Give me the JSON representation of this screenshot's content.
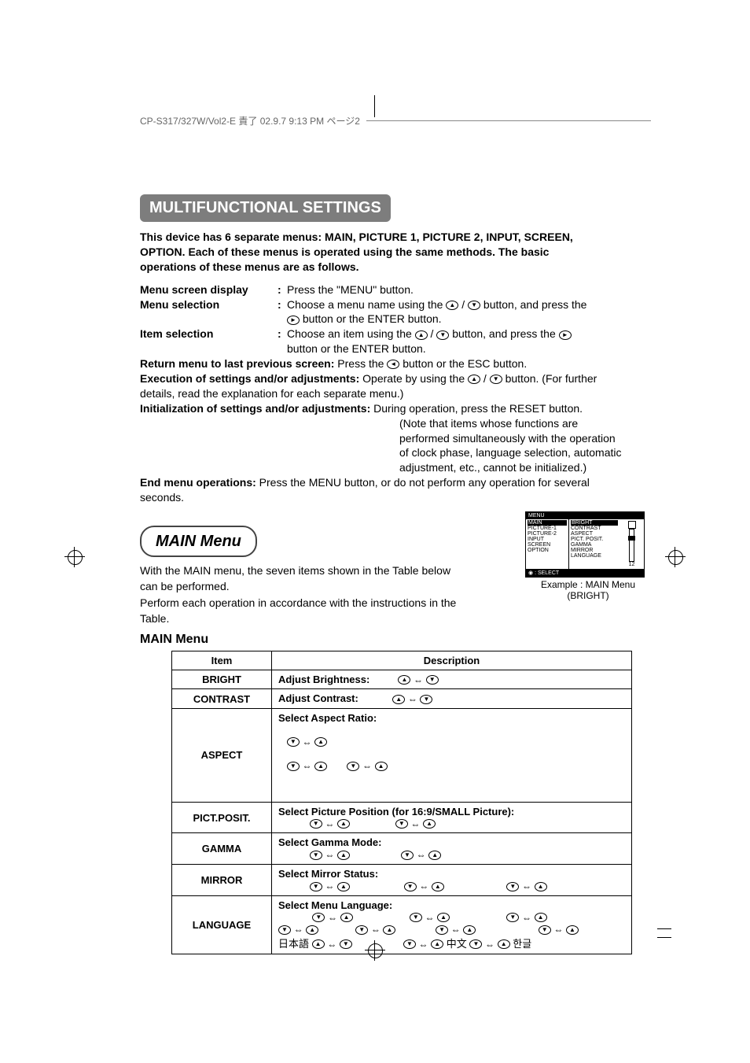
{
  "header": {
    "slug": "CP-S317/327W/Vol2-E  責了  02.9.7  9:13 PM   ページ2"
  },
  "section_title": "MULTIFUNCTIONAL SETTINGS",
  "intro": "This device has 6 separate menus: MAIN, PICTURE 1, PICTURE 2, INPUT, SCREEN, OPTION. Each of these menus is operated using the same methods. The basic operations of these menus are as follows.",
  "ops": {
    "menu_display": {
      "label": "Menu screen display",
      "body": "Press the \"MENU\" button."
    },
    "menu_selection": {
      "label": "Menu selection",
      "body1": "Choose a menu name using the ",
      "body2": " button, and press the ",
      "body3": " button or the ENTER button."
    },
    "item_selection": {
      "label": "Item selection",
      "body1": "Choose an item using the ",
      "body2": " button, and press the ",
      "body3": "button or the ENTER button."
    },
    "return": {
      "label": "Return menu to last previous screen:",
      "body": " Press the ",
      "body2": "button or the ESC button."
    },
    "exec": {
      "label": "Execution of settings and/or adjustments:",
      "body": " Operate by using the ",
      "body2": " button. (For further details, read the explanation for each separate menu.)"
    },
    "init": {
      "label": "Initialization of settings and/or adjustments:",
      "body": " During operation, press the RESET button.",
      "note": "(Note that items whose functions are performed simultaneously with the operation of clock phase, language selection, automatic adjustment, etc., cannot be initialized.)"
    },
    "end": {
      "label": "End menu operations:",
      "body": " Press the MENU button, or do not perform any operation for several seconds."
    }
  },
  "main_menu": {
    "pill": "MAIN Menu",
    "desc1": "With the MAIN menu, the seven items shown in the Table below can be performed.",
    "desc2": "Perform each operation in accordance with the instructions in the Table.",
    "table_title": "MAIN Menu",
    "example_title": "MENU",
    "example_left": [
      "MAIN",
      "PICTURE-1",
      "PICTURE-2",
      "INPUT",
      "SCREEN",
      "OPTION"
    ],
    "example_right": [
      "BRIGHT",
      "CONTRAST",
      "ASPECT",
      "PICT. POSIT.",
      "GAMMA",
      "MIRROR",
      "LANGUAGE"
    ],
    "example_value": "12",
    "example_foot": ": SELECT",
    "example_cap1": "Example : MAIN Menu",
    "example_cap2": "(BRIGHT)"
  },
  "table": {
    "head_item": "Item",
    "head_desc": "Description",
    "rows": [
      {
        "item": "BRIGHT",
        "desc_b": "Adjust Brightness:"
      },
      {
        "item": "CONTRAST",
        "desc_b": "Adjust Contrast:"
      },
      {
        "item": "ASPECT",
        "desc_b": "Select Aspect Ratio:"
      },
      {
        "item": "PICT.POSIT.",
        "desc_b": "Select Picture Position (for 16:9/SMALL Picture):"
      },
      {
        "item": "GAMMA",
        "desc_b": "Select Gamma Mode:"
      },
      {
        "item": "MIRROR",
        "desc_b": "Select Mirror Status:"
      },
      {
        "item": "LANGUAGE",
        "desc_b": "Select Menu Language:",
        "extra1": "日本語",
        "extra2": "中文",
        "extra3": "한글"
      }
    ]
  }
}
